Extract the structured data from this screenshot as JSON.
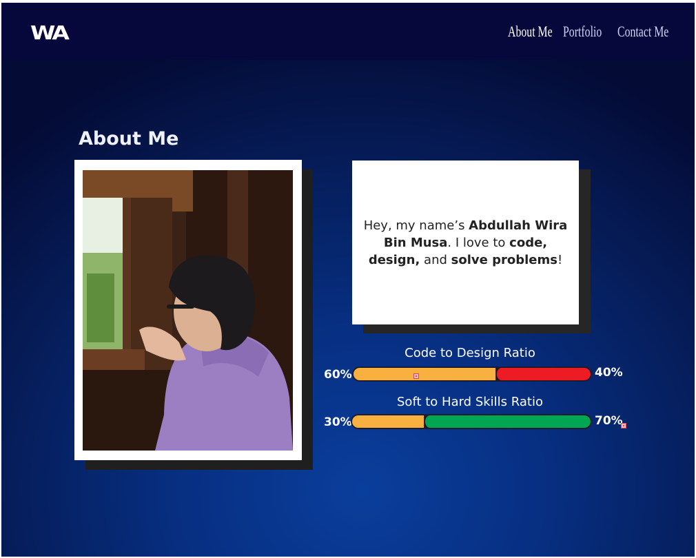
{
  "header": {
    "logo": "WA",
    "nav": [
      {
        "label": "About Me",
        "active": true
      },
      {
        "label": "Portfolio",
        "active": false
      },
      {
        "label": "Contact Me",
        "active": false
      }
    ]
  },
  "about": {
    "title": "About Me",
    "intro": {
      "pre": "Hey, my name’s ",
      "name": "Abdullah Wira Bin Musa",
      "mid": ". I love to ",
      "skills": "code, design,",
      "and": " and ",
      "solve": "solve problems",
      "end": "!"
    }
  },
  "ratios": [
    {
      "title": "Code to Design Ratio",
      "left_label": "60%",
      "right_label": "40%",
      "left_fraction": 0.6,
      "left_color": "#f8b040",
      "right_color": "#ed1c24"
    },
    {
      "title": "Soft to Hard Skills Ratio",
      "left_label": "30%",
      "right_label": "70%",
      "left_fraction": 0.3,
      "left_color": "#f8b040",
      "right_color": "#00a651"
    }
  ],
  "colors": {
    "navbar": "#06073a",
    "background_top": "#040b35",
    "background_center": "#0a3e9c"
  }
}
